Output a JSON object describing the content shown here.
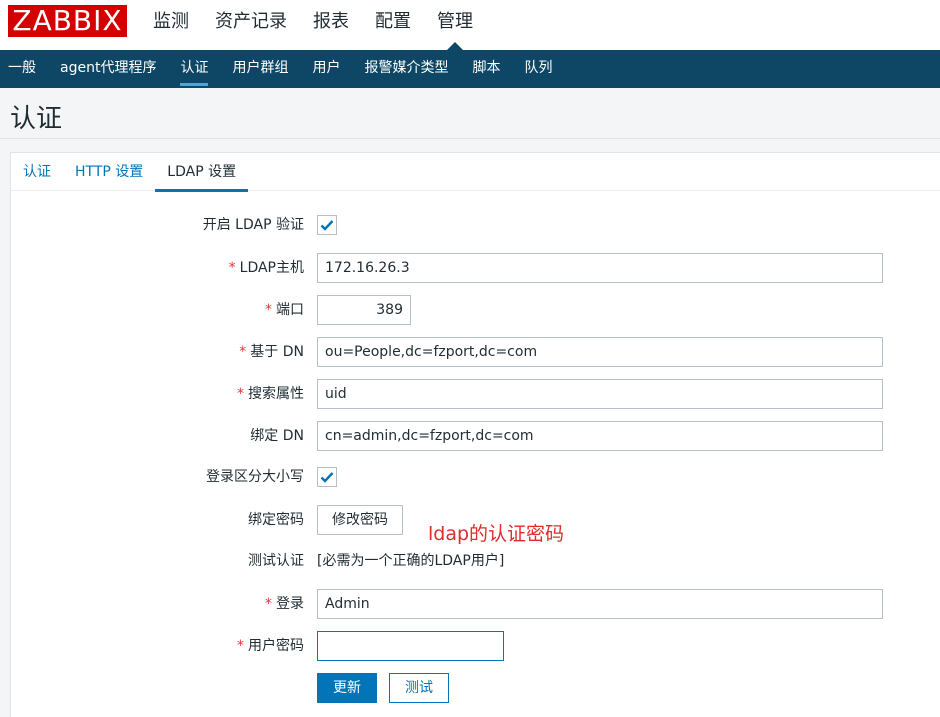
{
  "app": {
    "logo_text": "ZABBIX"
  },
  "main_menu": [
    {
      "label": "监测",
      "active": false
    },
    {
      "label": "资产记录",
      "active": false
    },
    {
      "label": "报表",
      "active": false
    },
    {
      "label": "配置",
      "active": false
    },
    {
      "label": "管理",
      "active": true
    }
  ],
  "sub_menu": [
    {
      "label": "一般",
      "active": false
    },
    {
      "label": "agent代理程序",
      "active": false
    },
    {
      "label": "认证",
      "active": true
    },
    {
      "label": "用户群组",
      "active": false
    },
    {
      "label": "用户",
      "active": false
    },
    {
      "label": "报警媒介类型",
      "active": false
    },
    {
      "label": "脚本",
      "active": false
    },
    {
      "label": "队列",
      "active": false
    }
  ],
  "page": {
    "title": "认证"
  },
  "tabs": [
    {
      "label": "认证",
      "active": false
    },
    {
      "label": "HTTP 设置",
      "active": false
    },
    {
      "label": "LDAP 设置",
      "active": true
    }
  ],
  "form": {
    "enable_ldap": {
      "label": "开启 LDAP 验证",
      "checked": true
    },
    "ldap_host": {
      "label": "LDAP主机",
      "required": true,
      "value": "172.16.26.3"
    },
    "port": {
      "label": "端口",
      "required": true,
      "value": "389"
    },
    "base_dn": {
      "label": "基于 DN",
      "required": true,
      "value": "ou=People,dc=fzport,dc=com"
    },
    "search_attribute": {
      "label": "搜索属性",
      "required": true,
      "value": "uid"
    },
    "bind_dn": {
      "label": "绑定 DN",
      "required": false,
      "value": "cn=admin,dc=fzport,dc=com"
    },
    "case_sensitive": {
      "label": "登录区分大小写",
      "checked": true
    },
    "bind_password": {
      "label": "绑定密码",
      "button": "修改密码"
    },
    "test_auth": {
      "label": "测试认证",
      "note": "[必需为一个正确的LDAP用户]"
    },
    "login": {
      "label": "登录",
      "required": true,
      "value": "Admin"
    },
    "user_password": {
      "label": "用户密码",
      "required": true,
      "value": ""
    },
    "required_marker": "*"
  },
  "annotation": {
    "text": "ldap的认证密码",
    "color": "#e02b2b"
  },
  "buttons": {
    "update": "更新",
    "test": "测试"
  },
  "colors": {
    "brand": "#d40000",
    "nav": "#0e4766",
    "accent": "#0275b8"
  }
}
